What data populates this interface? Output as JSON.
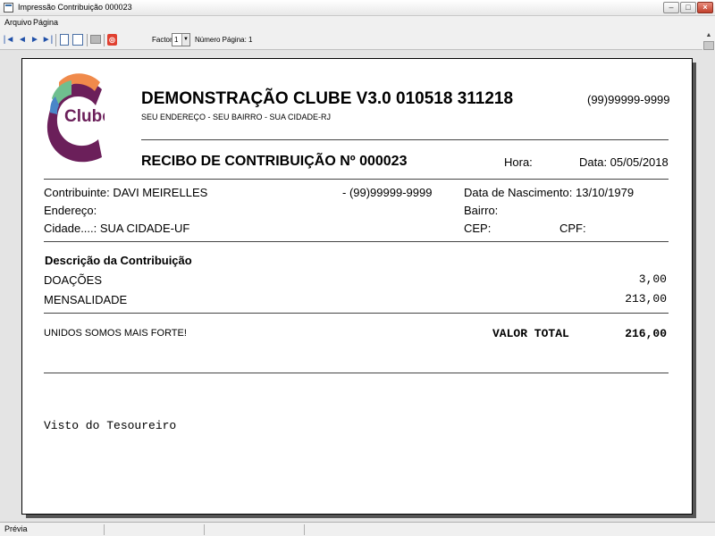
{
  "window": {
    "title": "Impressão Contribuição 000023"
  },
  "menu": {
    "items": [
      "Arquivo",
      "Página"
    ]
  },
  "toolbar": {
    "factor_label": "Factor:",
    "factor_value": "1",
    "page_label": "Número Página: 1"
  },
  "logo": {
    "text": "Clube",
    "colors": {
      "purple": "#6b1f5a",
      "orange": "#f08a4b",
      "green": "#6fbf8f",
      "blue": "#4a86c8"
    }
  },
  "receipt": {
    "club_name": "DEMONSTRAÇÃO CLUBE V3.0 010518 311218",
    "address": "SEU ENDEREÇO - SEU BAIRRO - SUA CIDADE-RJ",
    "club_phone": "(99)99999-9999",
    "title": "RECIBO DE CONTRIBUIÇÃO Nº 000023",
    "hora": "Hora:",
    "data": "Data: 05/05/2018",
    "contributor": "Contribuinte: DAVI MEIRELLES",
    "contributor_phone": "- (99)99999-9999",
    "birth_date": "Data de Nascimento: 13/10/1979",
    "endereco": "Endereço:",
    "bairro": "Bairro:",
    "cidade": "Cidade....: SUA CIDADE-UF",
    "cep": "CEP:",
    "cpf": "CPF:",
    "desc_title": "Descrição da Contribuição",
    "items": [
      {
        "label": "DOAÇÕES",
        "value": "3,00"
      },
      {
        "label": "MENSALIDADE",
        "value": "213,00"
      }
    ],
    "motto": "UNIDOS SOMOS MAIS FORTE!",
    "total_label": "VALOR TOTAL",
    "total_value": "216,00",
    "visto": "Visto do Tesoureiro"
  },
  "status": {
    "text": "Prévia"
  }
}
